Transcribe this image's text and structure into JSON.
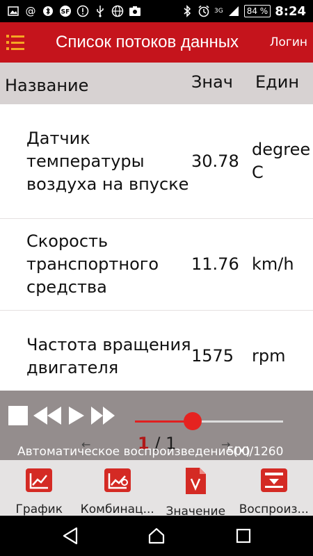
{
  "status_bar": {
    "icons": [
      "image-icon",
      "at-icon",
      "bluetooth-alt-icon",
      "sf-icon",
      "alert-icon",
      "usb-icon",
      "globe-icon",
      "camera-icon",
      "bluetooth-icon",
      "alarm-icon",
      "signal-icon"
    ],
    "network_label": "3G",
    "battery": "84 %",
    "time": "8:24"
  },
  "app_bar": {
    "title": "Список потоков данных",
    "login": "Логин",
    "menu_icon": "menu-icon",
    "accent_color": "#c5141c",
    "menu_color": "#f5a623"
  },
  "table": {
    "headers": {
      "name": "Название",
      "value": "Знач",
      "unit": "Един"
    },
    "rows": [
      {
        "name": "Датчик температуры воздуха на впуске",
        "value": "30.78",
        "unit": "degree C"
      },
      {
        "name": "Скорость транспортного средства",
        "value": "11.76",
        "unit": "km/h"
      },
      {
        "name": "Частота вращения двигателя",
        "value": "1575",
        "unit": "rpm"
      }
    ]
  },
  "player": {
    "controls": [
      "stop-icon",
      "rewind-icon",
      "play-icon",
      "fast-forward-icon"
    ],
    "progress": 0.39,
    "page_current": "1",
    "page_sep": " / ",
    "page_total": "1",
    "autoplay_label": "Автоматическое воспроизведение(X)",
    "speed_label": "500/1260"
  },
  "toolbar": {
    "items": [
      {
        "label": "График",
        "icon": "line-chart-icon"
      },
      {
        "label": "Комбинац...",
        "icon": "combined-chart-icon"
      },
      {
        "label": "Значение",
        "icon": "value-document-icon"
      },
      {
        "label": "Воспроиз...",
        "icon": "playback-icon"
      }
    ],
    "icon_color": "#d42a24"
  },
  "nav_bar": {
    "buttons": [
      "back-icon",
      "home-icon",
      "recents-icon"
    ]
  }
}
